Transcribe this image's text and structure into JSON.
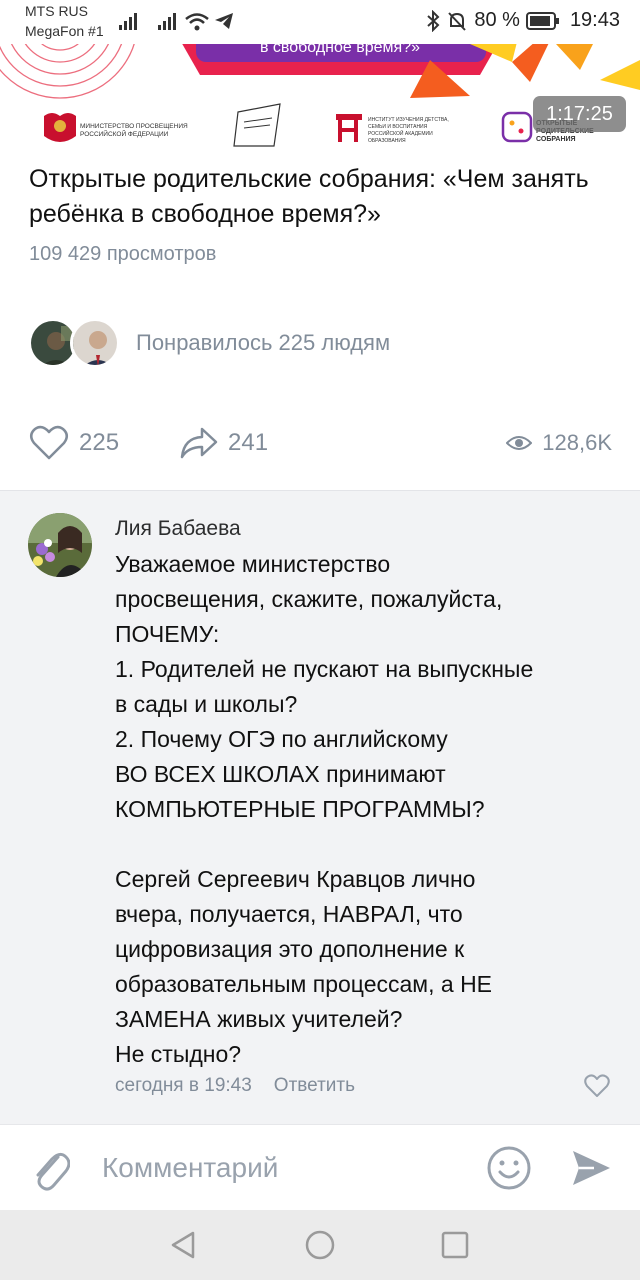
{
  "status_bar": {
    "carrier_1": "MTS RUS",
    "carrier_2": "MegaFon #1",
    "battery_percent": "80 %",
    "time": "19:43"
  },
  "banner": {
    "headline_fragment": "в свободное время?»",
    "logos": [
      {
        "name": "ministry-logo",
        "text": "МИНИСТЕРСТВО ПРОСВЕЩЕНИЯ РОССИЙСКОЙ ФЕДЕРАЦИИ"
      },
      {
        "name": "institute-logo",
        "text": "ИНСТИТУТ ИЗУЧЕНИЯ ДЕТСТВА, СЕМЬИ И ВОСПИТАНИЯ РОССИЙСКОЙ АКАДЕМИИ ОБРАЗОВАНИЯ"
      },
      {
        "name": "meetings-logo",
        "text": "ОТКРЫТЫЕ РОДИТЕЛЬСКИЕ СОБРАНИЯ"
      }
    ],
    "video_duration": "1:17:25"
  },
  "post": {
    "title": "Открытые родительские собрания: «Чем занять ребёнка в свободное время?»",
    "views_line": "109 429 просмотров",
    "liked_by": "Понравилось 225 людям",
    "like_count": "225",
    "share_count": "241",
    "view_count": "128,6K"
  },
  "comment": {
    "author": "Лия Бабаева",
    "text": "Уважаемое министерство\nпросвещения, скажите, пожалуйста,\nПОЧЕМУ:\n1. Родителей не пускают на выпускные\nв сады и школы?\n2. Почему ОГЭ по английскому\nВО ВСЕХ ШКОЛАХ принимают\nКОМПЬЮТЕРНЫЕ ПРОГРАММЫ?\n\nСергей Сергеевич Кравцов лично\nвчера, получается, НАВРАЛ, что\nцифровизация это дополнение к\nобразовательным процессам, а НЕ\nЗАМЕНА живых учителей?\nНе стыдно?",
    "timestamp": "сегодня в 19:43",
    "reply_label": "Ответить"
  },
  "composer": {
    "placeholder": "Комментарий"
  },
  "colors": {
    "secondary_text": "#818c99",
    "accent": "#818c99",
    "comments_bg": "#f2f3f5"
  }
}
